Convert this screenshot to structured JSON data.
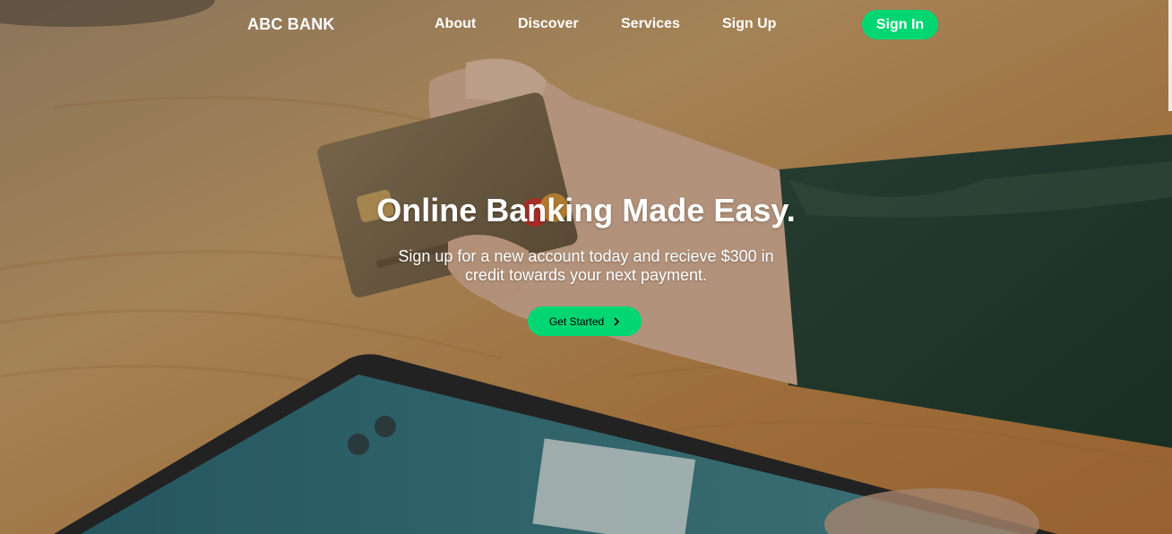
{
  "brand": {
    "name": "ABC BANK"
  },
  "nav": {
    "about": "About",
    "discover": "Discover",
    "services": "Services",
    "sign_up": "Sign Up",
    "sign_in": "Sign In"
  },
  "hero": {
    "headline": "Online Banking Made Easy.",
    "subtext": "Sign up for a new account today and recieve $300 in credit towards your next payment.",
    "cta_label": "Get Started",
    "cta_icon": "chevron-right-icon"
  },
  "colors": {
    "accent": "#01d673",
    "text_light": "#ffffff"
  }
}
